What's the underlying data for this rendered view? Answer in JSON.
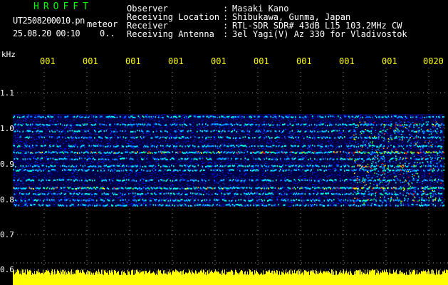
{
  "header": {
    "app_title": "HROFFT",
    "filename": "UT2508200010.pn",
    "mode": "meteor",
    "timestamp": "25.08.20 00:10",
    "timestamp_suffix": "0..",
    "info": [
      {
        "label": "Observer",
        "value": "Masaki Kano"
      },
      {
        "label": "Receiving Location",
        "value": "Shibukawa, Gunma, Japan"
      },
      {
        "label": "Receiver",
        "value": "RTL-SDR SDR# 43dB L15 103.2MHz CW"
      },
      {
        "label": "Receiving Antenna",
        "value": "3el Yagi(V) Az 330 for Vladivostok"
      }
    ],
    "separator": ":"
  },
  "axes": {
    "y_unit": "kHz",
    "y_ticks": [
      "1.1",
      "1.0",
      "0.9",
      "0.8",
      "0.7",
      "0.6"
    ],
    "time_ticks": [
      "001",
      "001",
      "001",
      "001",
      "001",
      "001",
      "001",
      "001",
      "001",
      "0020"
    ]
  },
  "colors": {
    "background": "#000000",
    "title": "#00ff00",
    "time_labels": "#ffff00",
    "signal_bar": "#ffff00",
    "signal_low": "#0000cc",
    "signal_high": "#ff0000"
  }
}
